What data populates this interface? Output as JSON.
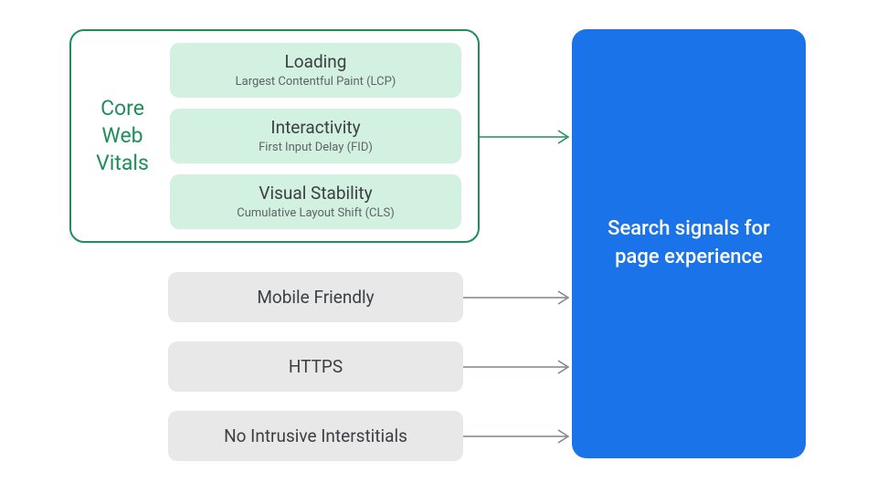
{
  "cwv": {
    "label": "Core Web Vitals",
    "metrics": [
      {
        "title": "Loading",
        "sub": "Largest Contentful Paint (LCP)"
      },
      {
        "title": "Interactivity",
        "sub": "First Input Delay (FID)"
      },
      {
        "title": "Visual Stability",
        "sub": "Cumulative Layout Shift (CLS)"
      }
    ]
  },
  "signals": {
    "mobile": "Mobile Friendly",
    "https": "HTTPS",
    "interstitials": "No Intrusive Interstitials"
  },
  "target": {
    "label": "Search signals for page experience"
  },
  "colors": {
    "green": "#1e8e5b",
    "gray": "#80868b",
    "blue": "#1a73e8"
  }
}
